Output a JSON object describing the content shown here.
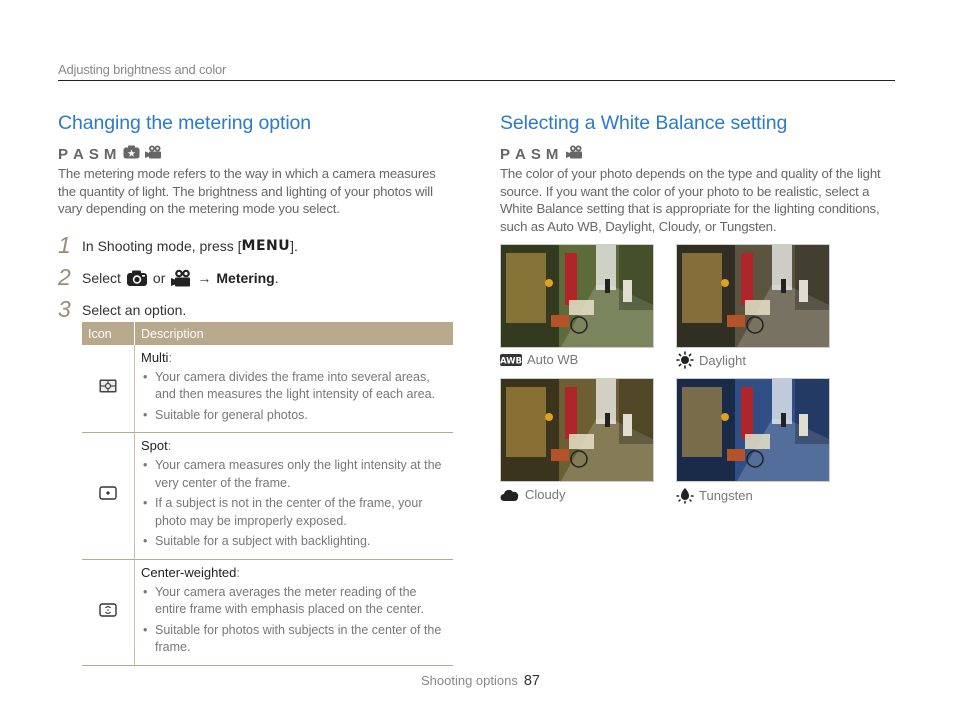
{
  "header": {
    "section": "Adjusting brightness and color"
  },
  "metering": {
    "title": "Changing the metering option",
    "modes": [
      "P",
      "A",
      "S",
      "M"
    ],
    "mode_icons": [
      "smart-mode-icon",
      "movie-mode-icon"
    ],
    "intro": "The metering mode refers to the way in which a camera measures the quantity of light. The brightness and lighting of your photos will vary depending on the metering mode you select.",
    "steps": [
      {
        "num": "1",
        "pre": "In Shooting mode, press [",
        "key": "MENU",
        "post": "]."
      },
      {
        "num": "2",
        "pre": "Select",
        "or": "or",
        "arrow": "→",
        "target": "Metering",
        "post": "."
      },
      {
        "num": "3",
        "text": "Select an option."
      }
    ],
    "table": {
      "headers": [
        "Icon",
        "Description"
      ],
      "rows": [
        {
          "icon": "multi-metering-icon",
          "title": "Multi",
          "bullets": [
            "Your camera divides the frame into several areas, and then measures the light intensity of each area.",
            "Suitable for general photos."
          ]
        },
        {
          "icon": "spot-metering-icon",
          "title": "Spot",
          "bullets": [
            "Your camera measures only the light intensity at the very center of the frame.",
            "If a subject is not in the center of the frame, your photo may be improperly exposed.",
            "Suitable for a subject with backlighting."
          ]
        },
        {
          "icon": "center-weighted-metering-icon",
          "title": "Center-weighted",
          "bullets": [
            "Your camera averages the meter reading of the entire frame with emphasis placed on the center.",
            "Suitable for photos with subjects in the center of the frame."
          ]
        }
      ]
    }
  },
  "white_balance": {
    "title": "Selecting a White Balance setting",
    "modes": [
      "P",
      "A",
      "S",
      "M"
    ],
    "mode_icons": [
      "movie-mode-icon"
    ],
    "intro": "The color of your photo depends on the type and quality of the light source. If you want the color of your photo to be realistic, select a White Balance setting that is appropriate for the lighting conditions, such as Auto WB, Daylight, Cloudy, or Tungsten.",
    "photos": [
      {
        "label": "Auto WB",
        "icon": "auto-wb-icon",
        "tint": "auto"
      },
      {
        "label": "Daylight",
        "icon": "daylight-icon",
        "tint": "daylight"
      },
      {
        "label": "Cloudy",
        "icon": "cloudy-icon",
        "tint": "cloudy"
      },
      {
        "label": "Tungsten",
        "icon": "tungsten-icon",
        "tint": "tungsten"
      }
    ],
    "tint_colors": {
      "auto": "#5d6a3a",
      "daylight": "#5a5440",
      "cloudy": "#6b5f33",
      "tungsten": "#2f4f86"
    }
  },
  "footer": {
    "section": "Shooting options",
    "page": "87"
  },
  "colors": {
    "heading": "#2a7bc6",
    "table_header": "#b8a88c",
    "step_number": "#9c8b72"
  }
}
